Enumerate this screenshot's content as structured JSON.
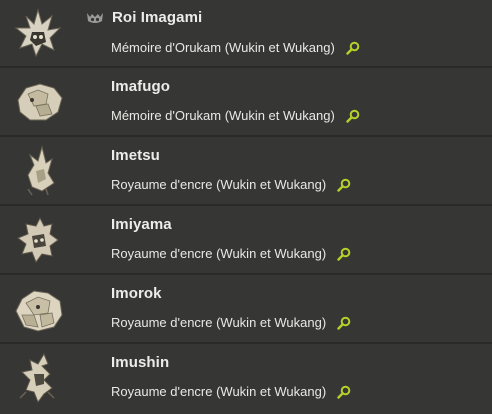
{
  "colors": {
    "row_background": "#363634",
    "row_divider": "#2a2a28",
    "name_text": "#ececea",
    "location_text": "#e8e8e4",
    "search_icon": "#b5d12a",
    "boss_icon": "#9a9a98"
  },
  "monsters": [
    {
      "name": "Roi Imagami",
      "location": "Mémoire d'Orukam (Wukin et Wukang)",
      "is_boss": true,
      "boss_icon": "boss-skull-icon",
      "action_icon": "search-icon"
    },
    {
      "name": "Imafugo",
      "location": "Mémoire d'Orukam (Wukin et Wukang)",
      "is_boss": false,
      "action_icon": "search-icon"
    },
    {
      "name": "Imetsu",
      "location": "Royaume d'encre (Wukin et Wukang)",
      "is_boss": false,
      "action_icon": "search-icon"
    },
    {
      "name": "Imiyama",
      "location": "Royaume d'encre (Wukin et Wukang)",
      "is_boss": false,
      "action_icon": "search-icon"
    },
    {
      "name": "Imorok",
      "location": "Royaume d'encre (Wukin et Wukang)",
      "is_boss": false,
      "action_icon": "search-icon"
    },
    {
      "name": "Imushin",
      "location": "Royaume d'encre (Wukin et Wukang)",
      "is_boss": false,
      "action_icon": "search-icon"
    }
  ]
}
